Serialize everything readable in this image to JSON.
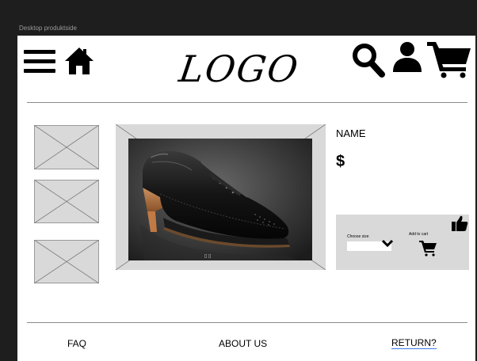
{
  "frame": {
    "label": "Desktop produktside"
  },
  "header": {
    "menu_icon": "hamburger-icon",
    "home_icon": "home-icon",
    "logo_text": "LOGO",
    "search_icon": "search-icon",
    "account_icon": "user-icon",
    "cart_icon": "cart-icon"
  },
  "gallery": {
    "thumbnails": [
      "image-placeholder",
      "image-placeholder",
      "image-placeholder"
    ],
    "main_image": "leather-shoe-photo",
    "main_image_caption": "▯ ▯"
  },
  "product": {
    "name": "NAME",
    "price": "$",
    "like_icon": "thumbs-up-icon",
    "size_label": "Choose size",
    "size_value": "",
    "add_to_cart_label": "Add to cart"
  },
  "footer": {
    "links": [
      "FAQ",
      "ABOUT US",
      "RETURN?"
    ]
  },
  "colors": {
    "background": "#1e1e1e",
    "placeholder": "#d9d9d9",
    "link_underline": "#3b7be8"
  }
}
